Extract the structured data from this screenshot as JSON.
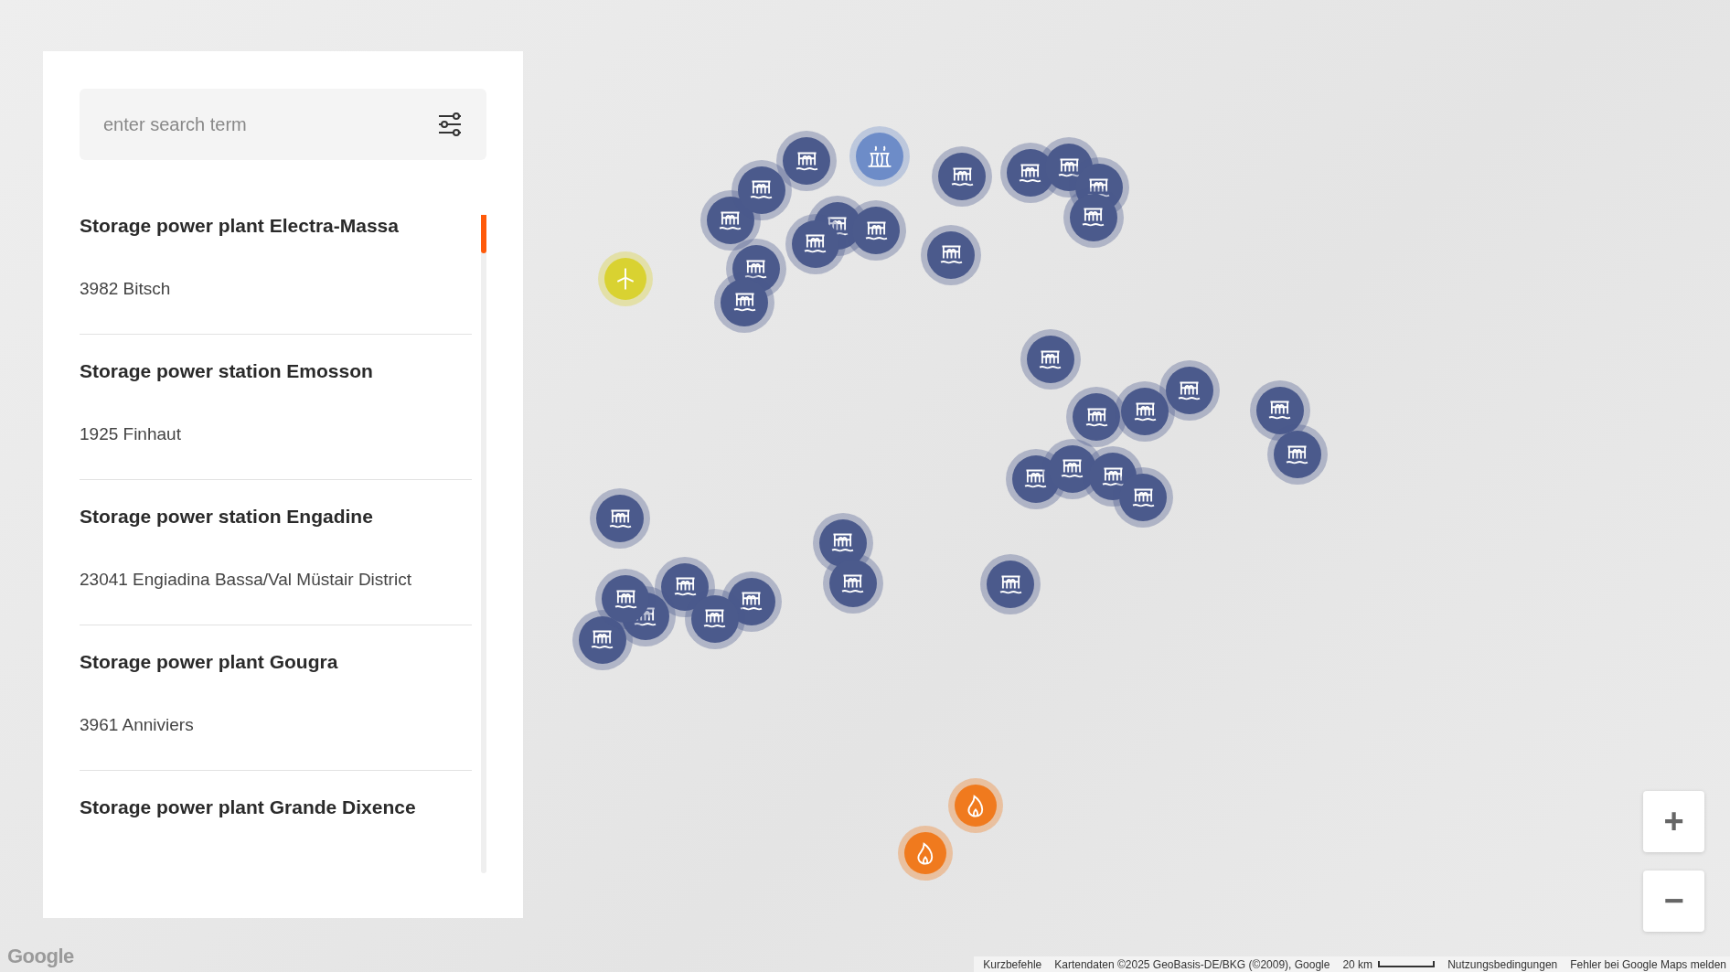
{
  "search": {
    "placeholder": "enter search term"
  },
  "results": [
    {
      "title": "Storage power plant Electra-Massa",
      "address": "3982 Bitsch"
    },
    {
      "title": "Storage power station Emosson",
      "address": "1925 Finhaut"
    },
    {
      "title": "Storage power station Engadine",
      "address": "23041 Engiadina Bassa/Val Müstair District"
    },
    {
      "title": "Storage power plant Gougra",
      "address": "3961 Anniviers"
    },
    {
      "title": "Storage power plant Grande Dixence"
    }
  ],
  "markers": [
    {
      "kind": "dam"
    },
    {
      "kind": "dam"
    },
    {
      "kind": "dam"
    },
    {
      "kind": "dam"
    },
    {
      "kind": "dam"
    },
    {
      "kind": "dam"
    },
    {
      "kind": "dam"
    },
    {
      "kind": "dam"
    },
    {
      "kind": "dam"
    },
    {
      "kind": "dam"
    },
    {
      "kind": "dam"
    },
    {
      "kind": "dam"
    },
    {
      "kind": "dam"
    },
    {
      "kind": "dam"
    },
    {
      "kind": "dam"
    },
    {
      "kind": "dam"
    },
    {
      "kind": "dam"
    },
    {
      "kind": "dam"
    },
    {
      "kind": "dam"
    },
    {
      "kind": "dam"
    },
    {
      "kind": "dam"
    },
    {
      "kind": "dam"
    },
    {
      "kind": "dam"
    },
    {
      "kind": "dam"
    },
    {
      "kind": "dam"
    },
    {
      "kind": "dam"
    },
    {
      "kind": "dam"
    },
    {
      "kind": "dam"
    },
    {
      "kind": "dam"
    },
    {
      "kind": "dam"
    },
    {
      "kind": "dam"
    },
    {
      "kind": "dam"
    },
    {
      "kind": "dam"
    },
    {
      "kind": "dam"
    },
    {
      "kind": "nuclear"
    },
    {
      "kind": "wind"
    },
    {
      "kind": "fire"
    },
    {
      "kind": "fire"
    }
  ],
  "zoom_controls": [
    "+",
    "−"
  ],
  "logo": "Google",
  "attribution": {
    "shortcuts": "Kurzbefehle",
    "map_data": "Kartendaten ©2025 GeoBasis-DE/BKG (©2009), Google",
    "scale": "20 km",
    "terms": "Nutzungsbedingungen",
    "report": "Fehler bei Google Maps melden"
  }
}
